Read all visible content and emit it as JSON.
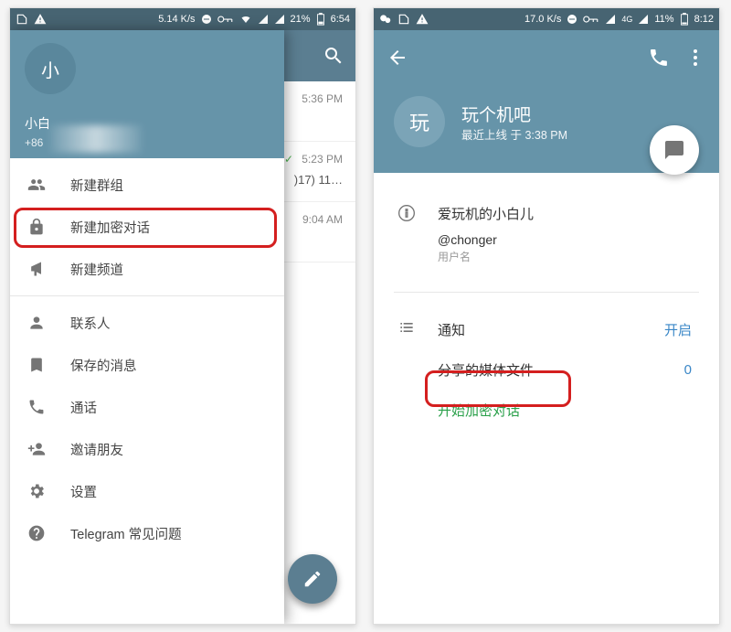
{
  "phone1": {
    "status": {
      "speed": "5.14 K/s",
      "battery": "21%",
      "time": "6:54"
    },
    "header": {
      "avatar_letter": "小",
      "name": "小白",
      "phone": "+86"
    },
    "menu": {
      "new_group": "新建群组",
      "new_secret": "新建加密对话",
      "new_channel": "新建频道",
      "contacts": "联系人",
      "saved": "保存的消息",
      "calls": "通话",
      "invite": "邀请朋友",
      "settings": "设置",
      "faq": "Telegram 常见问题"
    },
    "chats": [
      {
        "time": "5:36 PM"
      },
      {
        "time": "5:23 PM",
        "check": "✓",
        "text": ")17) 11…"
      },
      {
        "time": "9:04 AM"
      }
    ]
  },
  "phone2": {
    "status": {
      "speed": "17.0 K/s",
      "net": "4G",
      "battery": "11%",
      "time": "8:12"
    },
    "header": {
      "avatar_letter": "玩",
      "title": "玩个机吧",
      "subtitle": "最近上线 于 3:38 PM"
    },
    "info": {
      "display_name": "爱玩机的小白儿",
      "username": "@chonger",
      "username_label": "用户名"
    },
    "rows": {
      "notifications_label": "通知",
      "notifications_value": "开启",
      "shared_media_label": "分享的媒体文件",
      "shared_media_value": "0",
      "start_secret": "开始加密对话"
    }
  }
}
